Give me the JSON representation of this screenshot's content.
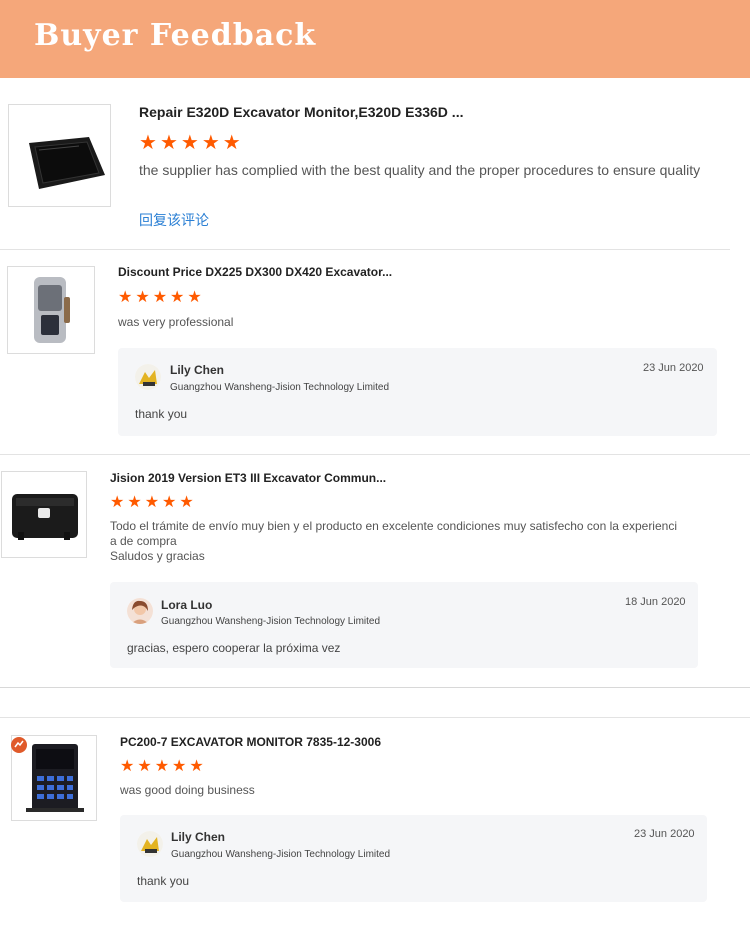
{
  "header": {
    "title": "Buyer Feedback"
  },
  "colors": {
    "banner": "#f5a77a",
    "star": "#ff5a00",
    "link": "#2a7fd4",
    "reply_bg": "#f5f6f8"
  },
  "reviews": [
    {
      "product_title": "Repair E320D Excavator Monitor,E320D E336D ...",
      "rating": 5,
      "text": "the supplier has complied with the best quality and the proper procedures to ensure quality",
      "action_link": "回复该评论"
    },
    {
      "product_title": "Discount Price DX225 DX300 DX420 Excavator...",
      "rating": 5,
      "text": "was very professional",
      "reply": {
        "name": "Lily Chen",
        "company": "Guangzhou Wansheng-Jision Technology Limited",
        "date": "23 Jun 2020",
        "message": "thank you"
      }
    },
    {
      "product_title": "Jision 2019 Version ET3 III Excavator Commun...",
      "rating": 5,
      "text_lines": [
        "Todo el trámite de envío muy bien y el producto en excelente condiciones muy satisfecho con la experienci",
        "a de compra",
        "Saludos y gracias"
      ],
      "reply": {
        "name": "Lora Luo",
        "company": "Guangzhou Wansheng-Jision Technology Limited",
        "date": "18 Jun 2020",
        "message": "gracias, espero cooperar la próxima vez"
      }
    },
    {
      "product_title": "PC200-7 EXCAVATOR MONITOR 7835-12-3006",
      "rating": 5,
      "text": "was good doing business",
      "reply": {
        "name": "Lily Chen",
        "company": "Guangzhou Wansheng-Jision Technology Limited",
        "date": "23 Jun 2020",
        "message": "thank you"
      }
    }
  ]
}
